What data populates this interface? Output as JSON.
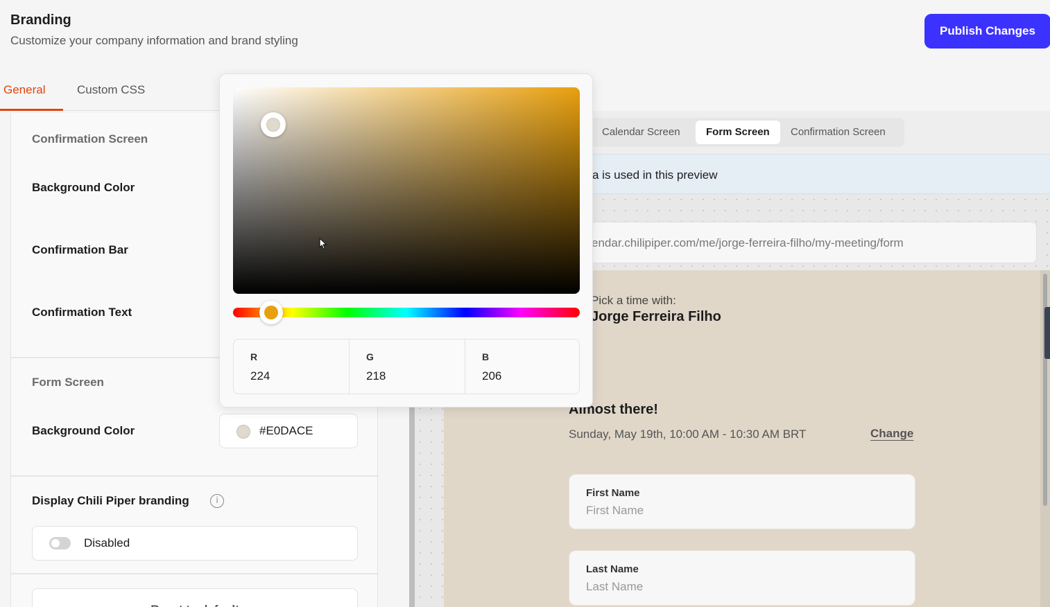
{
  "header": {
    "title": "Branding",
    "subtitle": "Customize your company information and brand styling",
    "publish_label": "Publish Changes"
  },
  "tabs": [
    {
      "label": "General",
      "active": true
    },
    {
      "label": "Custom CSS",
      "active": false
    }
  ],
  "left_panel": {
    "confirmation_section": {
      "title": "Confirmation Screen",
      "fields": [
        "Background Color",
        "Confirmation Bar",
        "Confirmation Text"
      ]
    },
    "form_section": {
      "title": "Form Screen",
      "background_label": "Background Color",
      "background_hex": "#E0DACE"
    },
    "branding": {
      "label": "Display Chili Piper branding",
      "toggle_label": "Disabled",
      "toggle_on": false
    },
    "reset_label": "Reset to default"
  },
  "color_picker": {
    "selected_color": "#e0dace",
    "hue_color": "#e8a00e",
    "rgb": [
      {
        "label": "R",
        "value": "224"
      },
      {
        "label": "G",
        "value": "218"
      },
      {
        "label": "B",
        "value": "206"
      }
    ]
  },
  "preview": {
    "screen_tabs": [
      {
        "label": "Calendar Screen",
        "active": false
      },
      {
        "label": "Form Screen",
        "active": true
      },
      {
        "label": "Confirmation Screen",
        "active": false
      }
    ],
    "info_banner": "a is used in this preview",
    "url": "endar.chilipiper.com/me/jorge-ferreira-filho/my-meeting/form",
    "pick_label": "Pick a time with:",
    "host_name": "Jorge Ferreira Filho",
    "heading": "Almost there!",
    "datetime": "Sunday, May 19th, 10:00 AM - 10:30 AM BRT",
    "change_label": "Change",
    "form_fields": [
      {
        "label": "First Name",
        "placeholder": "First Name"
      },
      {
        "label": "Last Name",
        "placeholder": "Last Name"
      }
    ]
  },
  "colors": {
    "accent": "#e0460e",
    "publish_button": "#3b32ff",
    "preview_background": "#e0d7c9"
  },
  "icons": {
    "info": "info-icon",
    "cursor": "cursor-icon"
  }
}
